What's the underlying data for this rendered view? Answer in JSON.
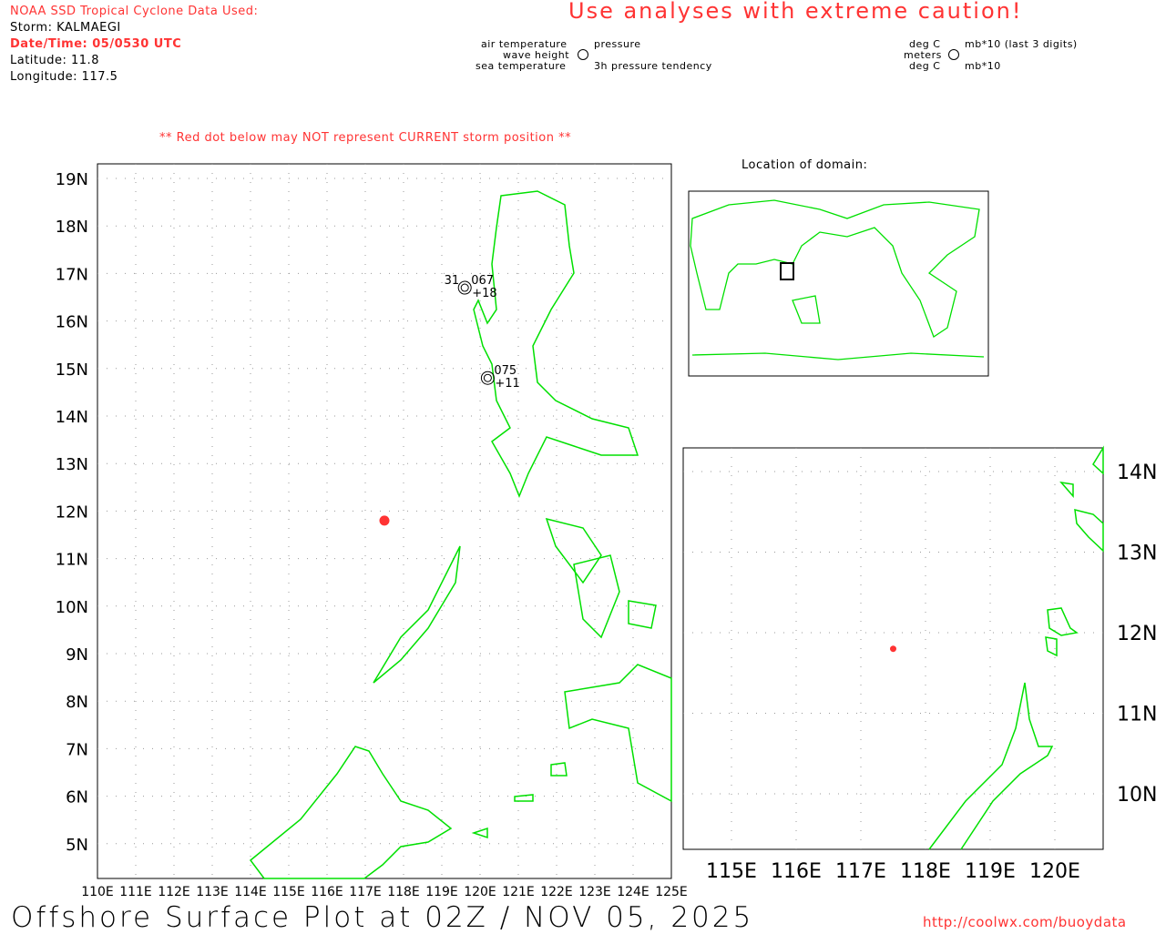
{
  "header": {
    "source": "NOAA SSD Tropical Cyclone Data Used:",
    "storm": "Storm: KALMAEGI",
    "datetime": "Date/Time: 05/0530 UTC",
    "latitude": "Latitude: 11.8",
    "longitude": "Longitude: 117.5",
    "caution": "Use analyses with extreme caution!",
    "warning": "** Red dot below may NOT represent CURRENT storm position **"
  },
  "legend": {
    "air_temp": "air temperature",
    "wave": "wave height",
    "sea_temp": "sea temperature",
    "pressure": "pressure",
    "tendency": "3h pressure tendency",
    "deg_c": "deg C",
    "meters": "meters",
    "deg_c2": "deg C",
    "mb": "mb*10 (last 3 digits)",
    "mb2": "mb*10"
  },
  "location_label": "Location of domain:",
  "main_map": {
    "lat_labels": [
      "19N",
      "18N",
      "17N",
      "16N",
      "15N",
      "14N",
      "13N",
      "12N",
      "11N",
      "10N",
      "9N",
      "8N",
      "7N",
      "6N",
      "5N"
    ],
    "lon_labels": [
      "110E",
      "111E",
      "112E",
      "113E",
      "114E",
      "115E",
      "116E",
      "117E",
      "118E",
      "119E",
      "120E",
      "121E",
      "122E",
      "123E",
      "124E",
      "125E"
    ],
    "storm": {
      "lat": 11.8,
      "lon": 117.5
    },
    "stations": [
      {
        "lat": 16.7,
        "lon": 119.6,
        "air": "31",
        "pressure": "067",
        "tendency": "+18"
      },
      {
        "lat": 14.8,
        "lon": 120.2,
        "air": "",
        "pressure": "075",
        "tendency": "+11"
      }
    ]
  },
  "inset_map": {
    "lat_labels": [
      "14N",
      "13N",
      "12N",
      "11N",
      "10N"
    ],
    "lon_labels": [
      "115E",
      "116E",
      "117E",
      "118E",
      "119E",
      "120E"
    ]
  },
  "footer": {
    "title": "Offshore Surface Plot at 02Z / NOV 05, 2025",
    "url": "http://coolwx.com/buoydata"
  },
  "colors": {
    "land": "#00e000",
    "storm": "#f33",
    "text_red": "#f33"
  }
}
